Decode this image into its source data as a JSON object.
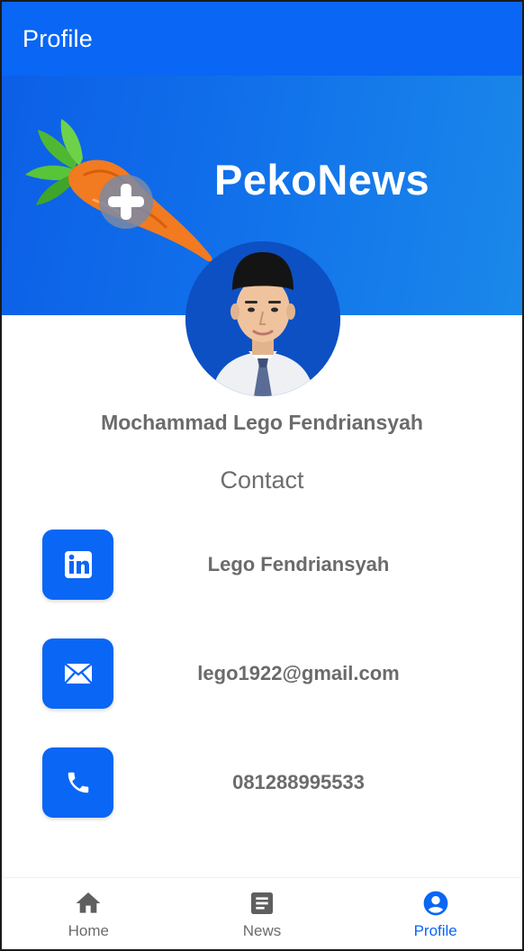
{
  "appbar": {
    "title": "Profile"
  },
  "banner": {
    "brand": "PekoNews"
  },
  "profile": {
    "name": "Mochammad Lego Fendriansyah",
    "contact_heading": "Contact"
  },
  "contacts": [
    {
      "icon": "linkedin-icon",
      "label": "Lego Fendriansyah"
    },
    {
      "icon": "mail-icon",
      "label": "lego1922@gmail.com"
    },
    {
      "icon": "phone-icon",
      "label": "081288995533"
    }
  ],
  "bottom_nav": {
    "items": [
      {
        "label": "Home",
        "icon": "home-icon",
        "active": false
      },
      {
        "label": "News",
        "icon": "article-icon",
        "active": false
      },
      {
        "label": "Profile",
        "icon": "account-circle-icon",
        "active": true
      }
    ]
  },
  "colors": {
    "primary": "#0a66f5",
    "text_gray": "#6b6b6b",
    "inactive_icon": "#5f5f5f"
  }
}
